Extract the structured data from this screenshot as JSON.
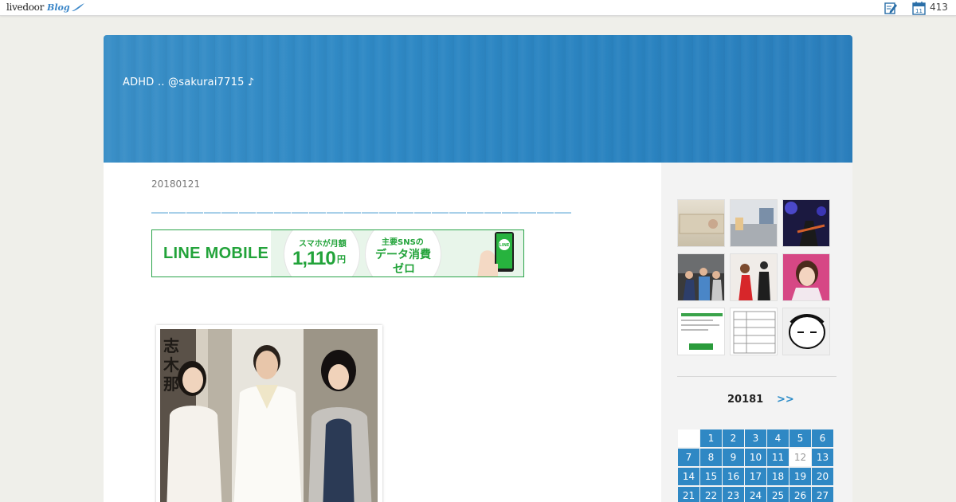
{
  "topbar": {
    "logo_text": "livedoor",
    "logo_blog": "Blog",
    "count": "413",
    "calendar_day": "11"
  },
  "header": {
    "blog_title": "ADHD ‥ @sakurai7715 ♪"
  },
  "post": {
    "date": "20180121",
    "title": "＿＿＿＿＿＿＿＿＿＿＿＿＿＿＿＿＿＿＿＿＿＿＿＿"
  },
  "ad": {
    "brand": "LINE MOBILE",
    "line1": "スマホが月額",
    "price": "1,110",
    "yen": "円",
    "line3": "主要SNSの",
    "line4": "データ消費",
    "line5": "ゼロ",
    "phone_label": "LINE"
  },
  "photo": {
    "sign_text": "志木那島"
  },
  "calendar": {
    "month_label": "20181",
    "next_label": ">>",
    "rows": [
      [
        "",
        "1",
        "2",
        "3",
        "4",
        "5",
        "6"
      ],
      [
        "7",
        "8",
        "9",
        "10",
        "11",
        "12",
        "13"
      ],
      [
        "14",
        "15",
        "16",
        "17",
        "18",
        "19",
        "20"
      ],
      [
        "21",
        "22",
        "23",
        "24",
        "25",
        "26",
        "27"
      ]
    ],
    "today": "12"
  },
  "colors": {
    "header_blue": "#2f89c5",
    "title_blue": "#2a8bc8",
    "ad_green": "#22a33a",
    "calendar_blue": "#2f88c4"
  }
}
